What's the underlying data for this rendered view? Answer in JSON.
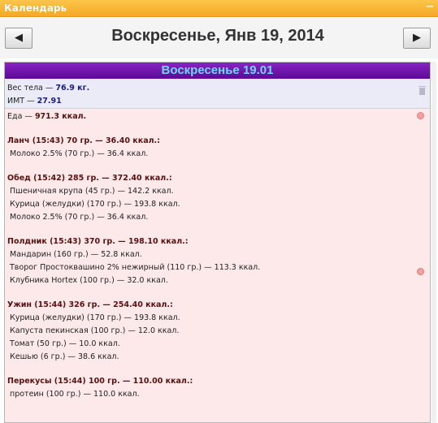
{
  "window": {
    "title": "Календарь",
    "collapse_symbol": "−"
  },
  "nav": {
    "prev_symbol": "◀",
    "next_symbol": "▶",
    "date_title": "Воскресенье, Янв 19, 2014"
  },
  "day": {
    "header": "Воскресенье 19.01",
    "weight_label": "Вес тела — ",
    "weight_value": "76.9 кг.",
    "bmi_label": "ИМТ — ",
    "bmi_value": "27.91"
  },
  "food": {
    "total_label": "Еда — ",
    "total_value": "971.3 ккал.",
    "meals": [
      {
        "title": "Ланч (15:43) 70 гр. — 36.40 ккал.:",
        "items": [
          "Молоко 2.5% (70 гр.) — 36.4 ккал."
        ]
      },
      {
        "title": "Обед (15:42) 285 гр. — 372.40 ккал.:",
        "items": [
          "Пшеничная крупа (45 гр.) — 142.2 ккал.",
          "Курица (желудки) (170 гр.) — 193.8 ккал.",
          "Молоко 2.5% (70 гр.) — 36.4 ккал."
        ]
      },
      {
        "title": "Полдник (15:43) 370 гр. — 198.10 ккал.:",
        "items": [
          "Мандарин (160 гр.) — 52.8 ккал.",
          "Творог Простоквашино 2% нежирный (110 гр.) — 113.3 ккал.",
          "Клубника Hortex (100 гр.) — 32.0 ккал."
        ]
      },
      {
        "title": "Ужин (15:44) 326 гр. — 254.40 ккал.:",
        "items": [
          "Курица (желудки) (170 гр.) — 193.8 ккал.",
          "Капуста пекинская (100 гр.) — 12.0 ккал.",
          "Томат (50 гр.) — 10.0 ккал.",
          "Кешью (6 гр.) — 38.6 ккал."
        ]
      },
      {
        "title": "Перекусы (15:44) 100 гр. — 110.00 ккал.:",
        "items": [
          "протеин (100 гр.) — 110.0 ккал."
        ]
      }
    ]
  }
}
